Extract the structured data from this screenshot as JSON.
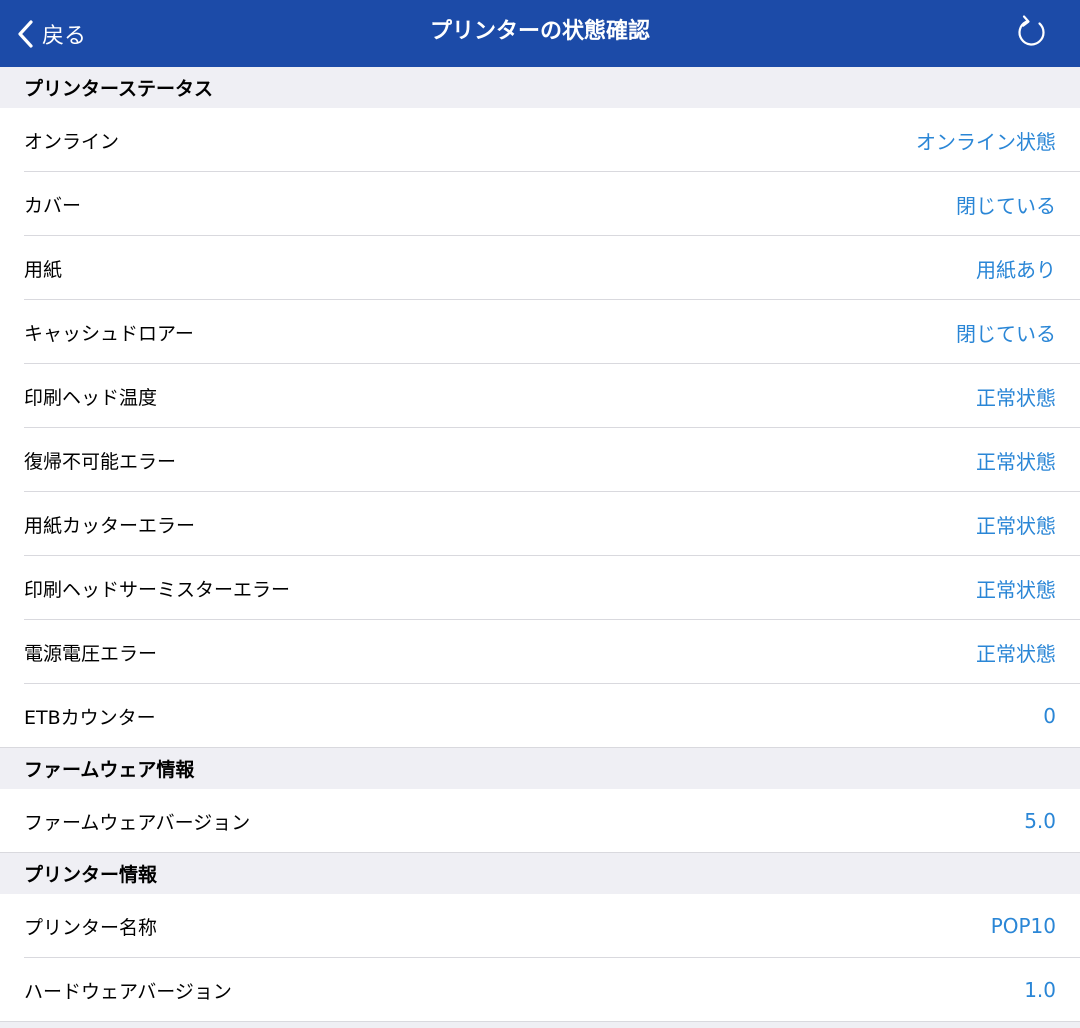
{
  "nav": {
    "back_label": "戻る",
    "title": "プリンターの状態確認",
    "refresh_icon": "refresh-icon",
    "back_icon": "chevron-left-icon",
    "bar_color": "#1c4ba8"
  },
  "value_color": "#2a86d6",
  "sections": [
    {
      "header": "プリンターステータス",
      "rows": [
        {
          "label": "オンライン",
          "value": "オンライン状態"
        },
        {
          "label": "カバー",
          "value": "閉じている"
        },
        {
          "label": "用紙",
          "value": "用紙あり"
        },
        {
          "label": "キャッシュドロアー",
          "value": "閉じている"
        },
        {
          "label": "印刷ヘッド温度",
          "value": "正常状態"
        },
        {
          "label": "復帰不可能エラー",
          "value": "正常状態"
        },
        {
          "label": "用紙カッターエラー",
          "value": "正常状態"
        },
        {
          "label": "印刷ヘッドサーミスターエラー",
          "value": "正常状態"
        },
        {
          "label": "電源電圧エラー",
          "value": "正常状態"
        },
        {
          "label": "ETBカウンター",
          "value": "0"
        }
      ]
    },
    {
      "header": "ファームウェア情報",
      "rows": [
        {
          "label": "ファームウェアバージョン",
          "value": "5.0"
        }
      ]
    },
    {
      "header": "プリンター情報",
      "rows": [
        {
          "label": "プリンター名称",
          "value": "POP10"
        },
        {
          "label": "ハードウェアバージョン",
          "value": "1.0"
        }
      ]
    }
  ]
}
